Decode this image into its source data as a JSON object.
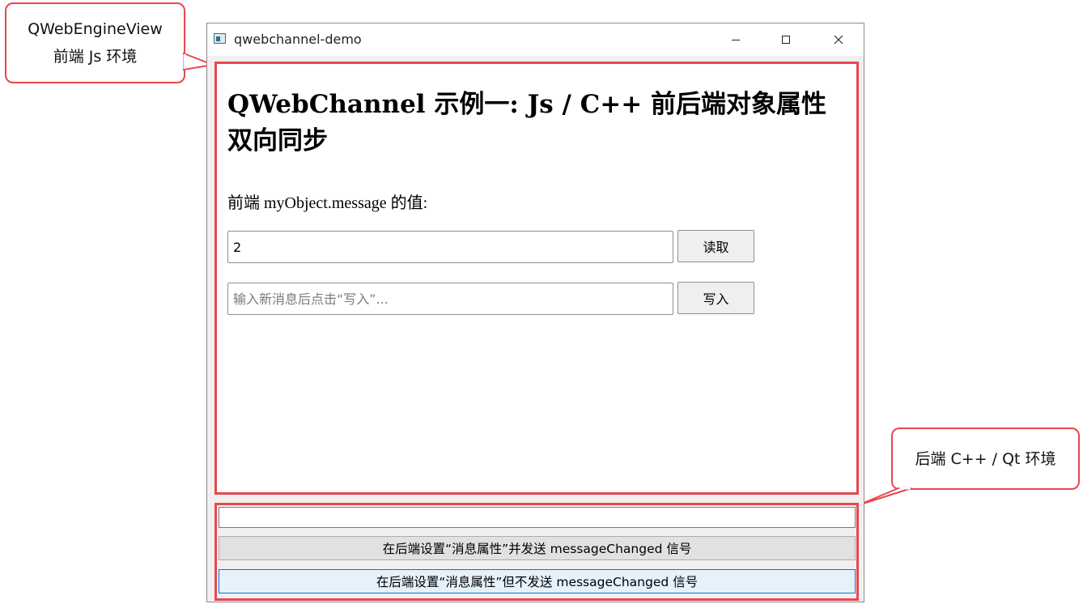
{
  "annotations": {
    "front": [
      "QWebEngineView",
      "前端 Js 环境"
    ],
    "back": "后端 C++ / Qt 环境"
  },
  "window": {
    "title": "qwebchannel-demo",
    "icons": [
      "app-icon",
      "minimize-icon",
      "maximize-icon",
      "close-icon"
    ]
  },
  "web": {
    "title": "QWebChannel 示例一: Js / C++ 前后端对象属性双向同步",
    "label": "前端 myObject.message 的值:",
    "value": "2",
    "read_button": "读取",
    "new_message_placeholder": "输入新消息后点击“写入”...",
    "write_button": "写入"
  },
  "backend": {
    "input_value": "",
    "send_signal_button": "在后端设置“消息属性”并发送 messageChanged 信号",
    "no_signal_button": "在后端设置“消息属性”但不发送 messageChanged 信号"
  },
  "colors": {
    "annotation_border": "#e8474f",
    "focused_button_border": "#0078d7",
    "focused_button_bg": "#e5f1fb"
  }
}
